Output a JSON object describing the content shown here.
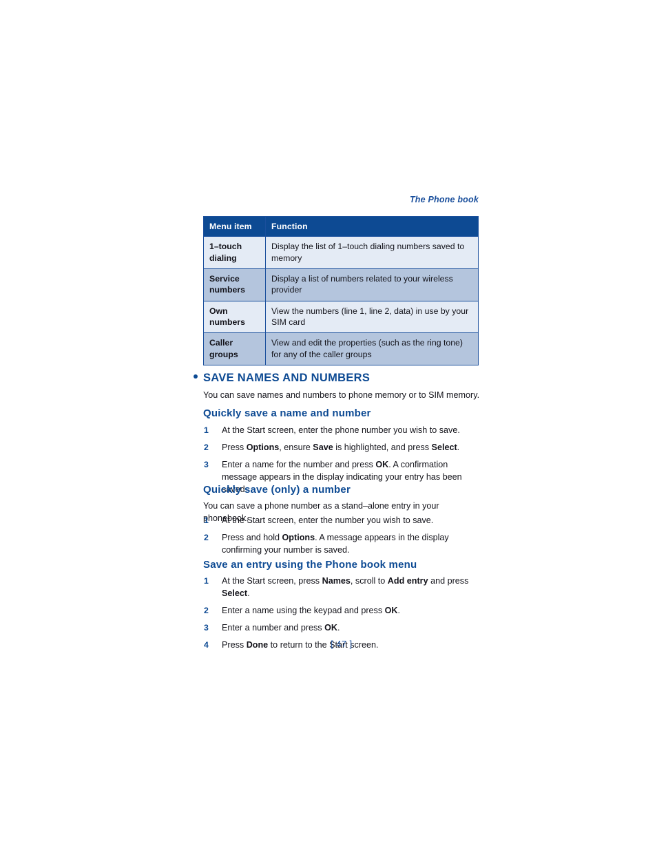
{
  "header": {
    "running_title": "The Phone book"
  },
  "table": {
    "columns": [
      "Menu item",
      "Function"
    ],
    "rows": [
      {
        "item": "1–touch dialing",
        "function": "Display the list of 1–touch dialing numbers saved to memory"
      },
      {
        "item": "Service numbers",
        "function": "Display a list of numbers related to your wireless provider"
      },
      {
        "item": "Own numbers",
        "function": "View the numbers (line 1, line 2, data) in use by your SIM card"
      },
      {
        "item": "Caller groups",
        "function": "View and edit the properties (such as the ring tone) for any of the caller groups"
      }
    ]
  },
  "section": {
    "title": "SAVE NAMES AND NUMBERS",
    "intro": "You can save names and numbers to phone memory or to SIM memory."
  },
  "subsections": [
    {
      "heading": "Quickly save a name and number",
      "intro": "",
      "steps": [
        {
          "num": "1",
          "text": "At the Start screen, enter the phone number you wish to save."
        },
        {
          "num": "2",
          "text": "Press <b>Options</b>, ensure <b>Save</b> is highlighted, and press <b>Select</b>."
        },
        {
          "num": "3",
          "text": "Enter a name for the number and press <b>OK</b>. A confirmation message appears in the display indicating your entry has been saved."
        }
      ]
    },
    {
      "heading": "Quickly save (only) a number",
      "intro": "You can save a phone number as a stand–alone entry in your phonebook.",
      "steps": [
        {
          "num": "1",
          "text": "At the Start screen, enter the number you wish to save."
        },
        {
          "num": "2",
          "text": "Press and hold <b>Options</b>. A message appears in the display confirming your number is saved."
        }
      ]
    },
    {
      "heading": "Save an entry using the Phone book menu",
      "intro": "",
      "steps": [
        {
          "num": "1",
          "text": "At the Start screen, press <b>Names</b>, scroll to <b>Add entry</b> and press <b>Select</b>."
        },
        {
          "num": "2",
          "text": "Enter a name using the keypad and press <b>OK</b>."
        },
        {
          "num": "3",
          "text": "Enter a number and press <b>OK</b>."
        },
        {
          "num": "4",
          "text": "Press <b>Done</b> to return to the Start screen."
        }
      ]
    }
  ],
  "footer": {
    "page_number": "[ 47 ]"
  },
  "colors": {
    "header_blue": "#0d4a93",
    "accent_blue": "#1a4f9c",
    "row_light": "#e4ebf5",
    "row_dark": "#b4c5dd",
    "body_text": "#13131a"
  }
}
